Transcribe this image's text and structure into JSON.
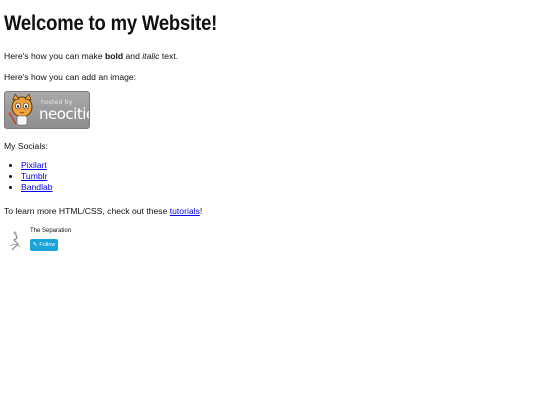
{
  "heading": "Welcome to my Website!",
  "intro": {
    "prefix": "Here's how you can make ",
    "bold": "bold",
    "middle": " and ",
    "italic": "italic",
    "suffix": " text."
  },
  "image_line": "Here's how you can add an image:",
  "badge": {
    "hosted_by": "hosted by",
    "brand": "neocities"
  },
  "socials": {
    "label": "My Socials:",
    "links": [
      "Pixilart",
      "Tumblr",
      "Bandlab"
    ]
  },
  "learn": {
    "prefix": "To learn more HTML/CSS, check out these ",
    "link": "tutorials",
    "suffix": "!"
  },
  "follow_widget": {
    "site_name": "The Separation",
    "button": "Follow"
  }
}
